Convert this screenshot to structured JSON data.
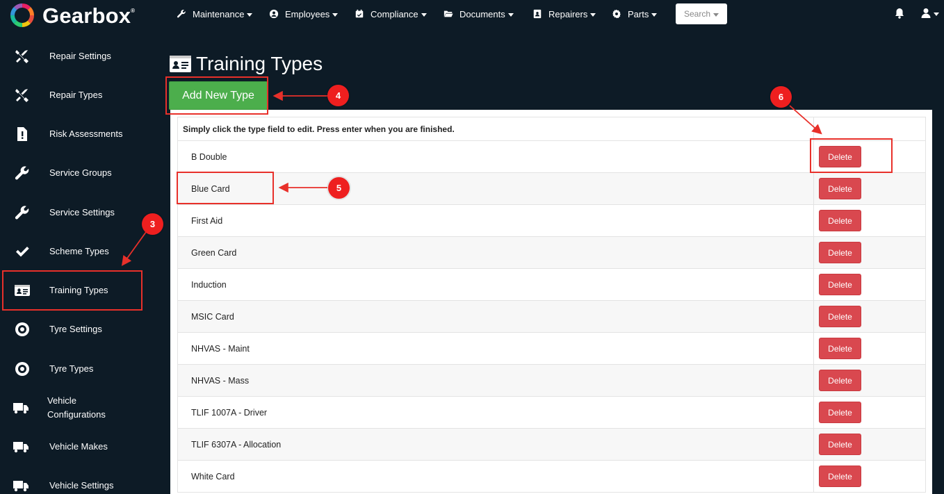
{
  "app": {
    "name": "Gearbox",
    "trademark": "®"
  },
  "nav": {
    "items": [
      {
        "label": "Maintenance",
        "icon": "wrench-icon"
      },
      {
        "label": "Employees",
        "icon": "user-circle-icon"
      },
      {
        "label": "Compliance",
        "icon": "calendar-check-icon"
      },
      {
        "label": "Documents",
        "icon": "folder-open-icon"
      },
      {
        "label": "Repairers",
        "icon": "address-book-icon"
      },
      {
        "label": "Parts",
        "icon": "gear-icon"
      }
    ],
    "search_label": "Search"
  },
  "sidebar": {
    "items": [
      {
        "label": "Repair Settings",
        "icon": "tools-icon"
      },
      {
        "label": "Repair Types",
        "icon": "tools-icon"
      },
      {
        "label": "Risk Assessments",
        "icon": "file-exclamation-icon"
      },
      {
        "label": "Service Groups",
        "icon": "wrench-icon"
      },
      {
        "label": "Service Settings",
        "icon": "wrench-icon"
      },
      {
        "label": "Scheme Types",
        "icon": "check-icon"
      },
      {
        "label": "Training Types",
        "icon": "id-card-icon"
      },
      {
        "label": "Tyre Settings",
        "icon": "tyre-icon"
      },
      {
        "label": "Tyre Types",
        "icon": "tyre-icon"
      },
      {
        "label": "Vehicle Configurations",
        "label_line1": "Vehicle",
        "label_line2": "Configurations",
        "icon": "truck-icon"
      },
      {
        "label": "Vehicle Makes",
        "icon": "truck-icon"
      },
      {
        "label": "Vehicle Settings",
        "icon": "truck-icon"
      }
    ]
  },
  "main": {
    "title": "Training Types",
    "title_icon": "id-card-icon",
    "add_button": "Add New Type",
    "table": {
      "instruction": "Simply click the type field to edit. Press enter when you are finished.",
      "delete_label": "Delete",
      "rows": [
        "B Double",
        "Blue Card",
        "First Aid",
        "Green Card",
        "Induction",
        "MSIC Card",
        "NHVAS - Maint",
        "NHVAS - Mass",
        "TLIF 1007A - Driver",
        "TLIF 6307A - Allocation",
        "White Card"
      ]
    }
  },
  "annotations": {
    "badges": [
      "3",
      "4",
      "5",
      "6"
    ],
    "color": "#ee1f1f"
  },
  "colors": {
    "background": "#0d1b26",
    "add_button": "#4cae4c",
    "delete_button": "#d9484f",
    "highlight": "#e8302a"
  }
}
